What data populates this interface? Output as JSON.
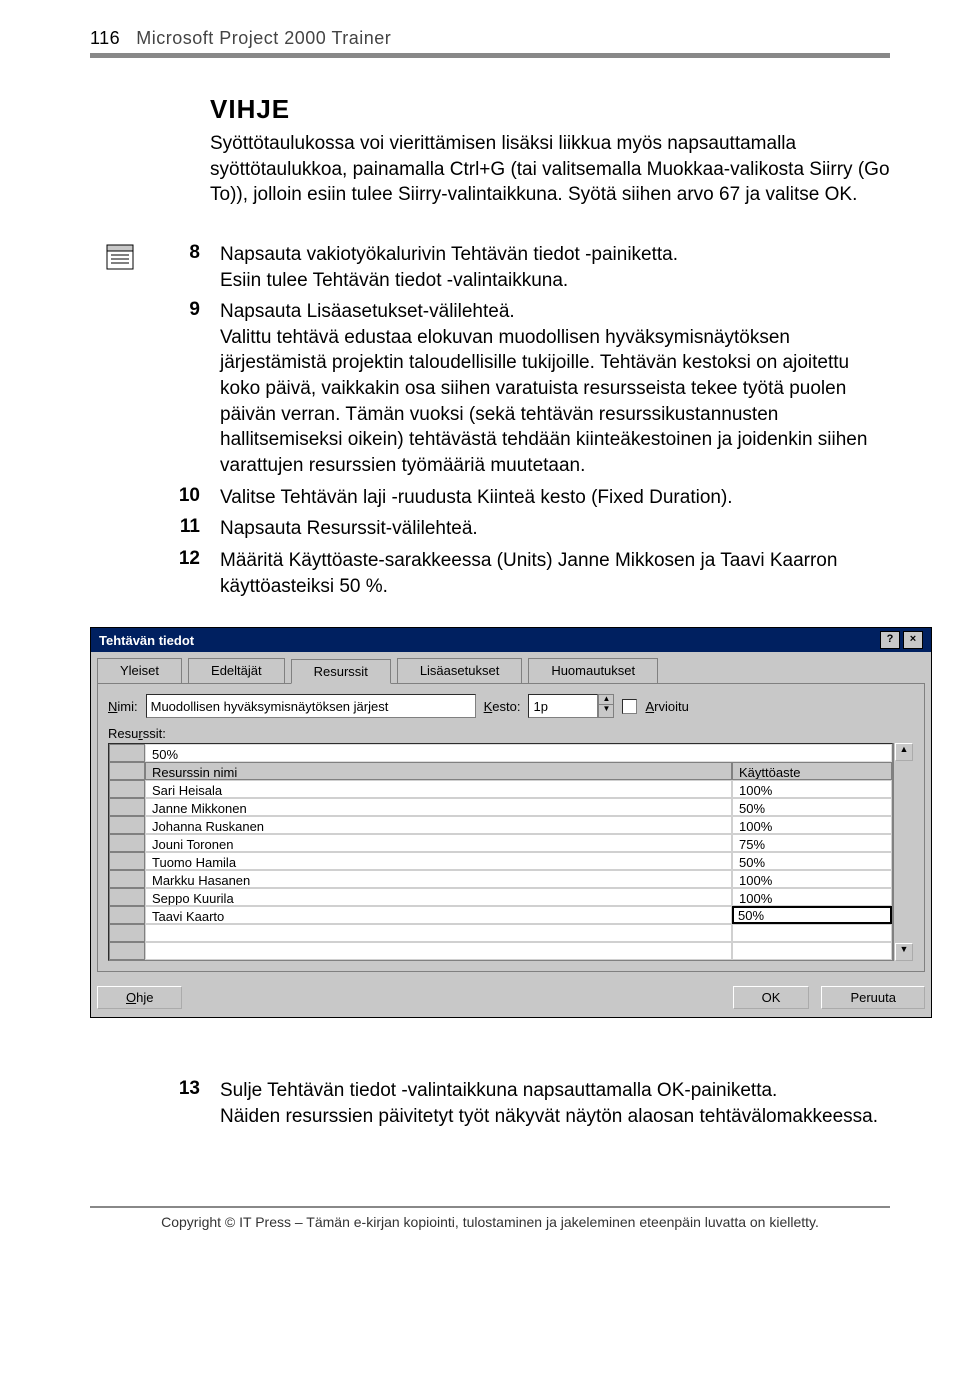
{
  "page": {
    "number": "116",
    "title": "Microsoft Project 2000 Trainer"
  },
  "tip": {
    "title": "VIHJE",
    "body": "Syöttötaulukossa voi vierittämisen lisäksi liikkua myös napsauttamalla syöttötaulukkoa, painamalla Ctrl+G (tai valitsemalla Muokkaa-valikosta Siirry (Go To)), jolloin esiin tulee Siirry-valintaikkuna. Syötä siihen arvo 67 ja valitse OK."
  },
  "steps": [
    {
      "num": "8",
      "lines": [
        "Napsauta vakiotyökalurivin Tehtävän tiedot -painiketta.",
        "Esiin tulee Tehtävän tiedot -valintaikkuna."
      ],
      "icon": true
    },
    {
      "num": "9",
      "lines": [
        "Napsauta Lisäasetukset-välilehteä.",
        "Valittu tehtävä edustaa elokuvan muodollisen hyväksymisnäytöksen järjestämistä projektin taloudellisille tukijoille. Tehtävän kestoksi on ajoitettu koko päivä, vaikkakin osa siihen varatuista resursseista tekee työtä puolen päivän verran. Tämän vuoksi (sekä tehtävän resurssikustannusten hallitsemiseksi oikein) tehtävästä tehdään kiinteäkestoinen ja joidenkin siihen varattujen resurssien työmääriä muutetaan."
      ]
    },
    {
      "num": "10",
      "lines": [
        "Valitse Tehtävän laji -ruudusta Kiinteä kesto (Fixed Duration)."
      ]
    },
    {
      "num": "11",
      "lines": [
        "Napsauta Resurssit-välilehteä."
      ]
    },
    {
      "num": "12",
      "lines": [
        "Määritä Käyttöaste-sarakkeessa (Units) Janne Mikkosen ja Taavi Kaarron käyttöasteiksi 50 %."
      ]
    }
  ],
  "dialog": {
    "title": "Tehtävän tiedot",
    "tabs": [
      "Yleiset",
      "Edeltäjät",
      "Resurssit",
      "Lisäasetukset",
      "Huomautukset"
    ],
    "active_tab": "Resurssit",
    "name_label": "Nimi:",
    "name_value": "Muodollisen hyväksymisnäytöksen järjest",
    "duration_label": "Kesto:",
    "duration_value": "1p",
    "estimated_label": "Arvioitu",
    "grid_label": "Resurssit:",
    "index_cell": "50%",
    "cols": [
      "Resurssin nimi",
      "Käyttöaste"
    ],
    "rows": [
      {
        "name": "Sari Heisala",
        "pct": "100%"
      },
      {
        "name": "Janne Mikkonen",
        "pct": "50%"
      },
      {
        "name": "Johanna Ruskanen",
        "pct": "100%"
      },
      {
        "name": "Jouni Toronen",
        "pct": "75%"
      },
      {
        "name": "Tuomo Hamila",
        "pct": "50%"
      },
      {
        "name": "Markku Hasanen",
        "pct": "100%"
      },
      {
        "name": "Seppo Kuurila",
        "pct": "100%"
      },
      {
        "name": "Taavi Kaarto",
        "pct": "50%",
        "editing": true
      }
    ],
    "help": "Ohje",
    "ok": "OK",
    "cancel": "Peruuta"
  },
  "steps2": [
    {
      "num": "13",
      "lines": [
        "Sulje Tehtävän tiedot -valintaikkuna napsauttamalla OK-painiketta.",
        "Näiden resurssien päivitetyt työt näkyvät näytön alaosan tehtävälomakkeessa."
      ]
    }
  ],
  "footer": "Copyright © IT Press – Tämän e-kirjan kopiointi, tulostaminen ja jakeleminen eteenpäin luvatta on kielletty."
}
